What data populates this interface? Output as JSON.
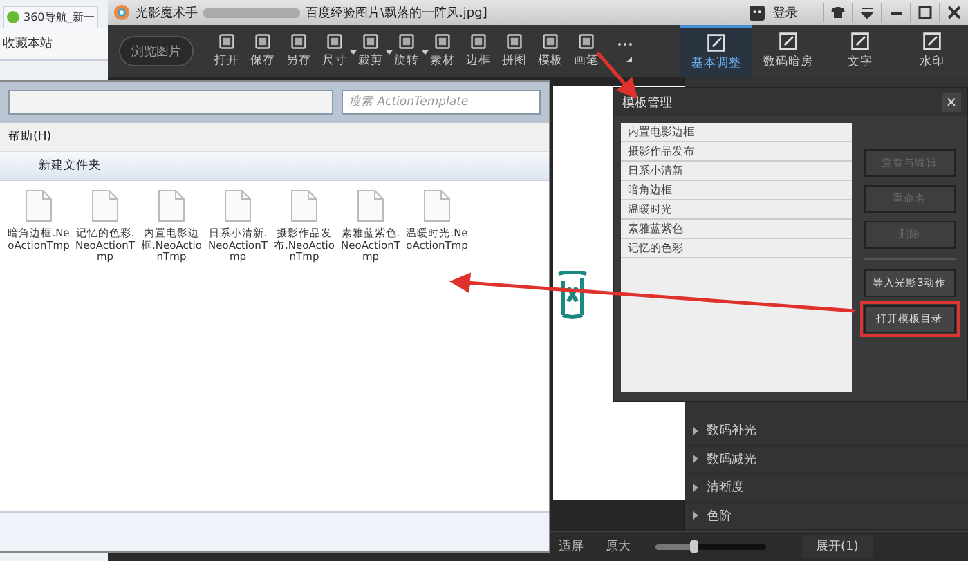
{
  "browser": {
    "tab": "360导航_新一",
    "bookmark": "收藏本站"
  },
  "app": {
    "name": "光影魔术手",
    "file": "百度经验图片\\飘落的一阵风.jpg]",
    "login": "登录",
    "browse_button": "浏览图片",
    "tools": [
      {
        "label": "打开",
        "dropdown": false
      },
      {
        "label": "保存",
        "dropdown": false
      },
      {
        "label": "另存",
        "dropdown": false
      },
      {
        "label": "尺寸",
        "dropdown": true
      },
      {
        "label": "裁剪",
        "dropdown": true
      },
      {
        "label": "旋转",
        "dropdown": true
      },
      {
        "label": "素材",
        "dropdown": false
      },
      {
        "label": "边框",
        "dropdown": false
      },
      {
        "label": "拼图",
        "dropdown": false
      },
      {
        "label": "模板",
        "dropdown": false
      },
      {
        "label": "画笔",
        "dropdown": false
      }
    ],
    "tabs": [
      {
        "label": "基本调整",
        "selected": true
      },
      {
        "label": "数码暗房",
        "selected": false
      },
      {
        "label": "文字",
        "selected": false
      },
      {
        "label": "水印",
        "selected": false
      }
    ],
    "panel_items": [
      "数码补光",
      "数码减光",
      "清晰度",
      "色阶"
    ],
    "bottom": {
      "fit": "适屏",
      "original": "原大",
      "zoom": {
        "level": 0.35
      },
      "expand": "展开(1)"
    }
  },
  "explorer": {
    "search": {
      "placeholder": "搜索 ActionTemplate"
    },
    "menu": "帮助(H)",
    "new_folder": "新建文件夹",
    "files": [
      "暗角边框.NeoActionTmp",
      "记忆的色彩.NeoActionTmp",
      "内置电影边框.NeoActionTmp",
      "日系小清新.NeoActionTmp",
      "摄影作品发布.NeoActionTmp",
      "素雅蓝紫色.NeoActionTmp",
      "温暖时光.NeoActionTmp"
    ]
  },
  "dialog": {
    "title": "模板管理",
    "close": "×",
    "items": [
      "内置电影边框",
      "摄影作品发布",
      "日系小清新",
      "暗角边框",
      "温暖时光",
      "素雅蓝紫色",
      "记忆的色彩"
    ],
    "buttons": [
      {
        "label": "查看与编辑",
        "disabled": true,
        "highlighted": false
      },
      {
        "label": "重命名",
        "disabled": true,
        "highlighted": false
      },
      {
        "label": "删除",
        "disabled": true,
        "highlighted": false
      },
      {
        "label": "导入光影3动作",
        "disabled": false,
        "highlighted": false
      },
      {
        "label": "打开模板目录",
        "disabled": false,
        "highlighted": true
      }
    ]
  }
}
